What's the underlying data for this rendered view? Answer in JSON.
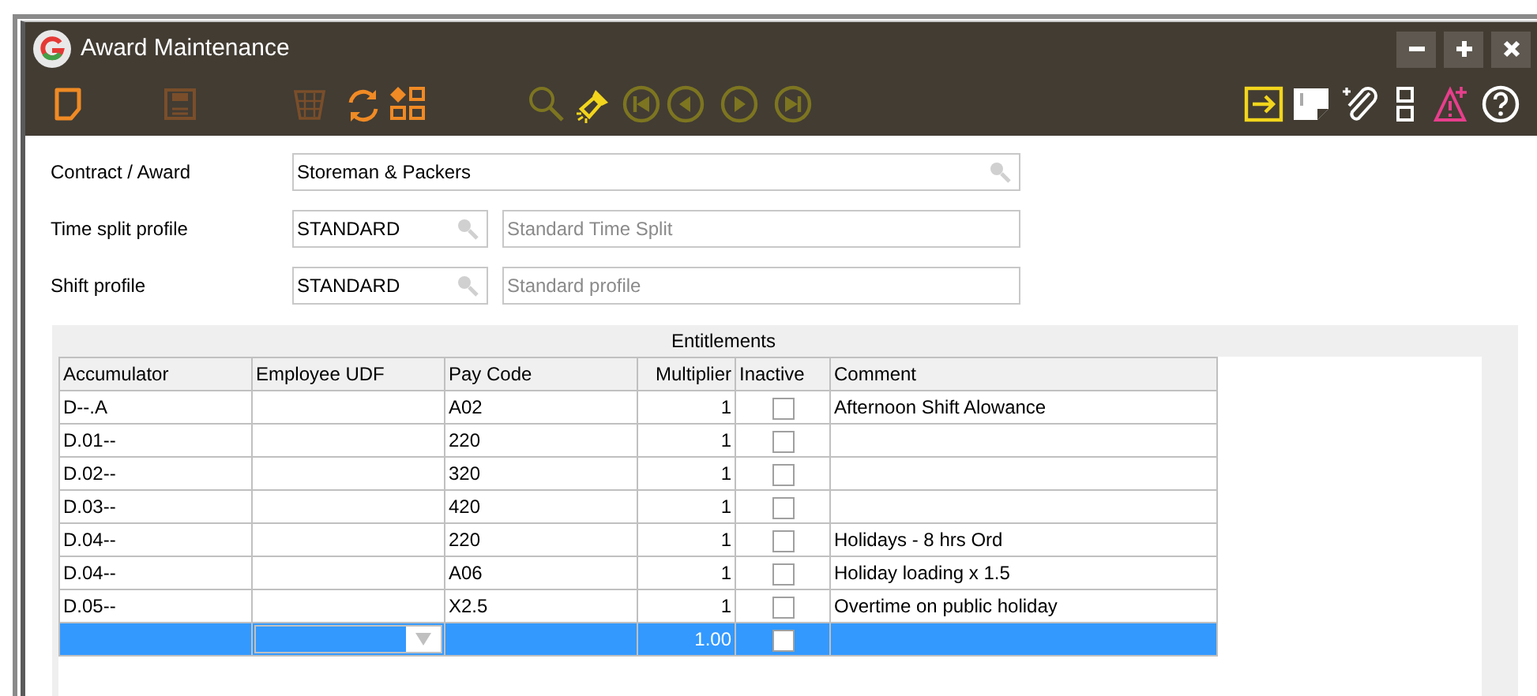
{
  "window": {
    "title": "Award Maintenance",
    "controls": [
      {
        "kind": "minimize"
      },
      {
        "kind": "maximize"
      },
      {
        "kind": "close"
      }
    ]
  },
  "toolbar_left": [
    {
      "kind": "new",
      "disabled": false
    },
    {
      "kind": "save",
      "disabled": true
    },
    {
      "kind": "delete",
      "disabled": true
    },
    {
      "kind": "refresh",
      "disabled": false
    },
    {
      "kind": "hierarchy",
      "disabled": false
    },
    {
      "kind": "search",
      "disabled": true
    },
    {
      "kind": "flashlight",
      "disabled": false
    },
    {
      "kind": "first",
      "disabled": true
    },
    {
      "kind": "previous",
      "disabled": true
    },
    {
      "kind": "next",
      "disabled": true
    },
    {
      "kind": "last",
      "disabled": true
    }
  ],
  "toolbar_right": [
    {
      "kind": "exit"
    },
    {
      "kind": "note"
    },
    {
      "kind": "attach"
    },
    {
      "kind": "layout"
    },
    {
      "kind": "alert"
    },
    {
      "kind": "help"
    }
  ],
  "form": {
    "contract": {
      "label": "Contract / Award",
      "value": "Storeman & Packers"
    },
    "time_split": {
      "label": "Time split profile",
      "value": "STANDARD",
      "description": "Standard Time Split"
    },
    "shift": {
      "label": "Shift profile",
      "value": "STANDARD",
      "description": "Standard profile"
    }
  },
  "table": {
    "title": "Entitlements",
    "columns": [
      "Accumulator",
      "Employee UDF",
      "Pay Code",
      "Multiplier",
      "Inactive",
      "Comment"
    ],
    "rows": [
      {
        "accumulator": "D--.A",
        "pay_code": "A02",
        "multiplier": "1",
        "inactive": false,
        "comment": "Afternoon Shift Alowance",
        "selected": false
      },
      {
        "accumulator": "D.01--",
        "pay_code": "220",
        "multiplier": "1",
        "inactive": false,
        "selected": false
      },
      {
        "accumulator": "D.02--",
        "pay_code": "320",
        "multiplier": "1",
        "inactive": false,
        "selected": false
      },
      {
        "accumulator": "D.03--",
        "pay_code": "420",
        "multiplier": "1",
        "inactive": false,
        "selected": false
      },
      {
        "accumulator": "D.04--",
        "pay_code": "220",
        "multiplier": "1",
        "inactive": false,
        "comment": "Holidays - 8 hrs Ord",
        "selected": false
      },
      {
        "accumulator": "D.04--",
        "pay_code": "A06",
        "multiplier": "1",
        "inactive": false,
        "comment": "Holiday loading x 1.5",
        "selected": false
      },
      {
        "accumulator": "D.05--",
        "pay_code": "X2.5",
        "multiplier": "1",
        "inactive": false,
        "comment": "Overtime on public holiday",
        "selected": false
      },
      {
        "multiplier": "1.00",
        "inactive": false,
        "selected": true
      }
    ]
  }
}
